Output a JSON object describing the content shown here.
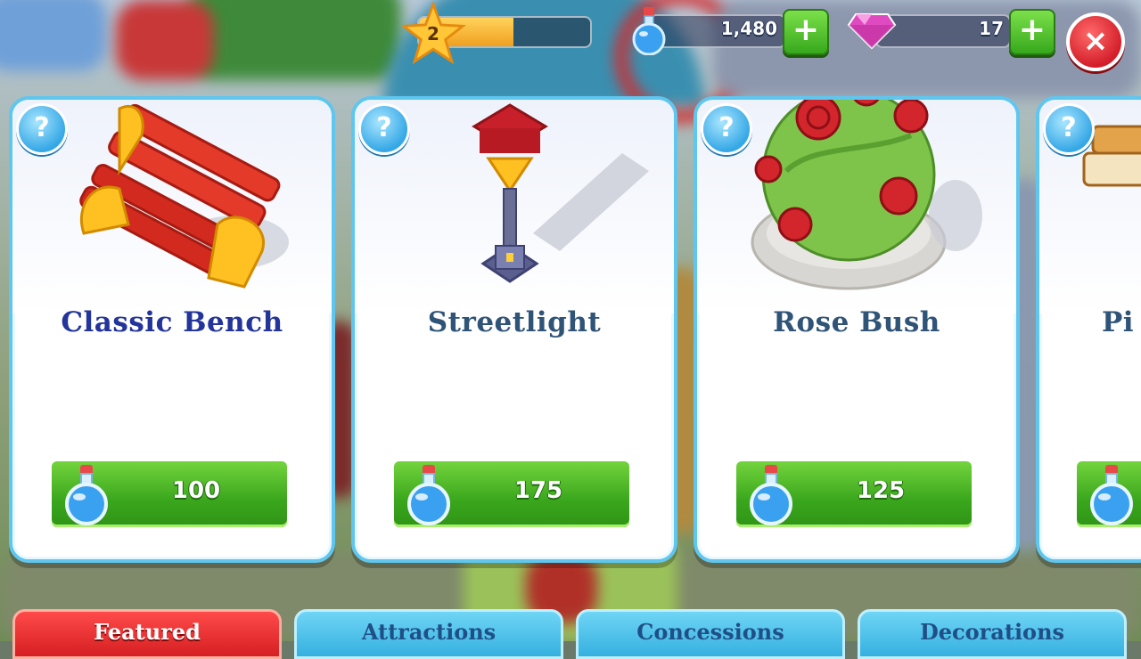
{
  "hud": {
    "level": "2",
    "level_progress": 0.55,
    "magic_amount": "1,480",
    "gem_amount": "17",
    "magic_icon": "potion-icon",
    "gem_icon": "gem-icon",
    "add_magic_label": "+",
    "add_gems_label": "+",
    "close_label": "×"
  },
  "cards": [
    {
      "help": "?",
      "title": "Classic Bench",
      "title_color": "#23349a",
      "price": "100",
      "art": "bench-icon"
    },
    {
      "help": "?",
      "title": "Streetlight",
      "title_color": "#2f5478",
      "price": "175",
      "art": "streetlight-icon"
    },
    {
      "help": "?",
      "title": "Rose Bush",
      "title_color": "#2f5478",
      "price": "125",
      "art": "rose-bush-icon"
    },
    {
      "help": "?",
      "title": "Pi",
      "title_color": "#2f5478",
      "price": "",
      "art": "bench-icon"
    }
  ],
  "tabs": [
    {
      "label": "Featured",
      "active": true
    },
    {
      "label": "Attractions",
      "active": false
    },
    {
      "label": "Concessions",
      "active": false
    },
    {
      "label": "Decorations",
      "active": false
    }
  ],
  "colors": {
    "card_border": "#5ec6ef",
    "price_green": "#3aa61c",
    "tab_active": "#d51f22",
    "tab_inactive": "#35b0e0"
  }
}
